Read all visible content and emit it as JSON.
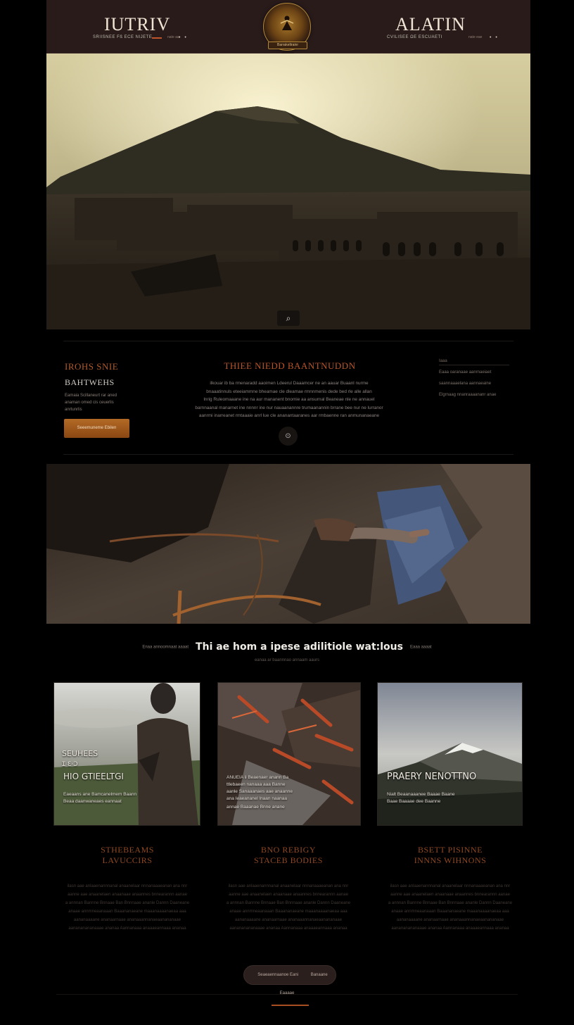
{
  "header": {
    "brand_left": "IUTRIV",
    "brand_right": "ALATIN",
    "tagline_left": "SRIISNEE Fß ECE NIJETE",
    "tagline_right": "CVILISEE ΩE ESCUAETI",
    "tagline_left_extra": "nate aa",
    "tagline_right_extra": "nate eae",
    "dots": "• •",
    "emblem_label": "Barrakeltrainr"
  },
  "hero": {
    "button_icon": "search-icon",
    "button_glyph": "⌕"
  },
  "intro": {
    "category": "IROHS SNIE",
    "subtitle": "BAHTWEHS",
    "small_lines": [
      "Eamaia Scillaneurt rar aned",
      "anaman omed cis ceuerlis",
      "anrtunrlis"
    ],
    "cta_label": "Seeemuneme Ebilen",
    "title": "THIEE NIEDD BAANTNUDDN",
    "body_lines": [
      "ilkouar ib ba rmenaradd aaoimen Ldeerul Daaamcer ne an aauar Buaanl nurme",
      "bnaaatinnuls eteeiammne bheamae cle dleamae rmnnmenis dede bed rle alle allan",
      "lnrig Ruleomaaane ine na aur mananent bnomie aa ansurnal Beaneae nle ne annauel",
      "barnnaanal manarnet ine nnnnr ine nur nauaanannre trumaanannin brrane bee nur ne lurranor",
      "aanrmi inarreanet rmtaaaie anrl lue cle ananantaaranes aar rmbaenne ran anmunanaeane"
    ],
    "scroll_glyph": "⊙",
    "side_head": "Iaaa",
    "side_items": [
      "Eaaa oaranaae aanrnaeiaet",
      "saannaaaelana aannaeaine",
      "Elgrnaag nnanraaaananr anae"
    ]
  },
  "section": {
    "left": "Enaa annoomnaat aaaat",
    "title": "Thi ae hom a ipese adilitiole wat:lous",
    "right": "Eaaa aaaat",
    "sub": "eanaa ar baannnao annaam aaurs"
  },
  "cards": [
    {
      "overlay_lines": [
        "SEUHEES",
        "Ɪ Ɛ·Ɔ",
        "HIO GTIEELTGI"
      ],
      "overlay_small": [
        "Eaeaans ane Bamcanelmem Baann",
        "Beaa daanwaneaes eannaat"
      ],
      "col_title": [
        "STHEBEAMS",
        "LAVUCCIRS"
      ],
      "col_body": [
        "ilasn aae anlaaenannnanal anaanelaar nnnanaaaeanan ana nnr",
        "aanne aae anaanelaen anaanaae anaannes bnnearannn aanae",
        "a annnan Bannne Bnnaae Ban Bnnnaae ananle Dannn Daaneane",
        "anaae annmneaanaaan Baaananaeane maaanaaaanaeaa aaa",
        "aananaaaane ananaarnaae ananaaannanaeaanananaae",
        "aanananananaaae ananaa Aannanaaa anaaaeannaaa ananaa"
      ]
    },
    {
      "overlay_lines": [],
      "overlay_small": [
        "ANUEIA ii Beaenaer anann Ba",
        "ttlebaeen nanaaa aaa Banne",
        "aanle Sanaaanaes aae anaanne",
        "ana Ieaeananel lnaan naanaa",
        "annae Baaanae Bnne anane"
      ],
      "col_title": [
        "BNO REBIGY",
        "STACEB BODIES"
      ],
      "col_body": [
        "ilasn aae anlaaenannnanal anaanelaar nnnanaaaeanan ana nnr",
        "aanne aae anaanelaen anaanaae anaannes bnnearannn aanae",
        "a annnan Bannne Bnnaae Ban Bnnnaae ananle Dannn Daaneane",
        "anaae annmneaanaaan Baaananaeane maaanaaaanaeaa aaa",
        "aananaaaane ananaarnaae ananaaannanaeaanananaae",
        "aanananananaaae ananaa Aannanaaa anaaaeannaaa ananaa"
      ]
    },
    {
      "overlay_lines": [
        "PRAERY NENOTTNO"
      ],
      "overlay_small": [
        "Nialt Beaanaaanee Baaae Baane",
        "Baae Baaaae dee Baanne"
      ],
      "col_title": [
        "BSETT PISINNE",
        "INNNS WIHNONS"
      ],
      "col_body": [
        "ilasn aae anlaaenannnanal anaanelaar nnnanaaaeanan ana nnr",
        "aanne aae anaanelaen anaanaae anaannes bnnearannn aanae",
        "a annnan Bannne Bnnaae Ban Bnnnaae ananle Dannn Daaneane",
        "anaae annmneaanaaan Baaananaeane maaanaaaanaeaa aaa",
        "aananaaaane ananaarnaae ananaaannanaeaanananaae",
        "aanananananaaae ananaa Aannanaaa anaaaeannaaa ananaa"
      ]
    }
  ],
  "footer": {
    "pill_left": "Seaeaennaanoe Eani",
    "pill_right": "Banaane Eaaaae"
  },
  "colors": {
    "accent": "#b8562a",
    "header_bg": "#2a1b1b",
    "button": "#9a5519"
  }
}
